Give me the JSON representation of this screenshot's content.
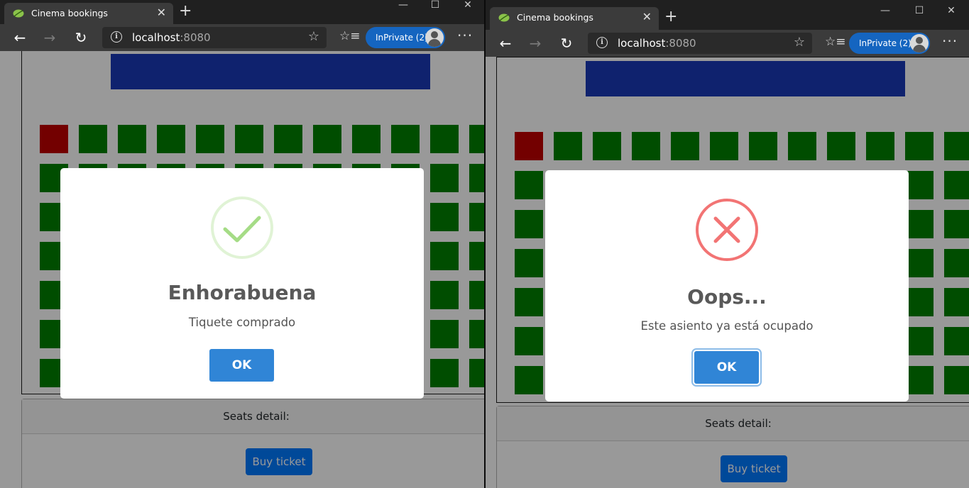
{
  "windows": [
    {
      "id": "left",
      "tab_title": "Cinema bookings",
      "url_host": "localhost",
      "url_port": ":8080",
      "inprivate_label": "InPrivate (2)",
      "seats_detail_label": "Seats detail:",
      "buy_button_label": "Buy ticket",
      "taken_seat": {
        "row": 1,
        "col": 1
      },
      "dialog": {
        "type": "success",
        "title": "Enhorabuena",
        "text": "Tiquete comprado",
        "ok_label": "OK"
      }
    },
    {
      "id": "right",
      "tab_title": "Cinema bookings",
      "url_host": "localhost",
      "url_port": ":8080",
      "inprivate_label": "InPrivate (2)",
      "seats_detail_label": "Seats detail:",
      "buy_button_label": "Buy ticket",
      "taken_seat": {
        "row": 1,
        "col": 1
      },
      "dialog": {
        "type": "error",
        "title": "Oops...",
        "text": "Este asiento ya está ocupado",
        "ok_label": "OK"
      }
    }
  ],
  "colors": {
    "seat_free": "#008000",
    "seat_taken": "#c00000",
    "screen": "#1939b7",
    "ok_button": "#3085d6",
    "buy_button": "#007bff",
    "success_icon": "#a5dc86",
    "error_icon": "#f27474"
  },
  "icons": {
    "favicon": "leaf-icon",
    "back": "arrow-left-icon",
    "forward": "arrow-right-icon",
    "refresh": "refresh-icon",
    "info": "info-icon",
    "favorite": "star-icon",
    "favorites_list": "favorites-icon",
    "more": "ellipsis-icon"
  }
}
